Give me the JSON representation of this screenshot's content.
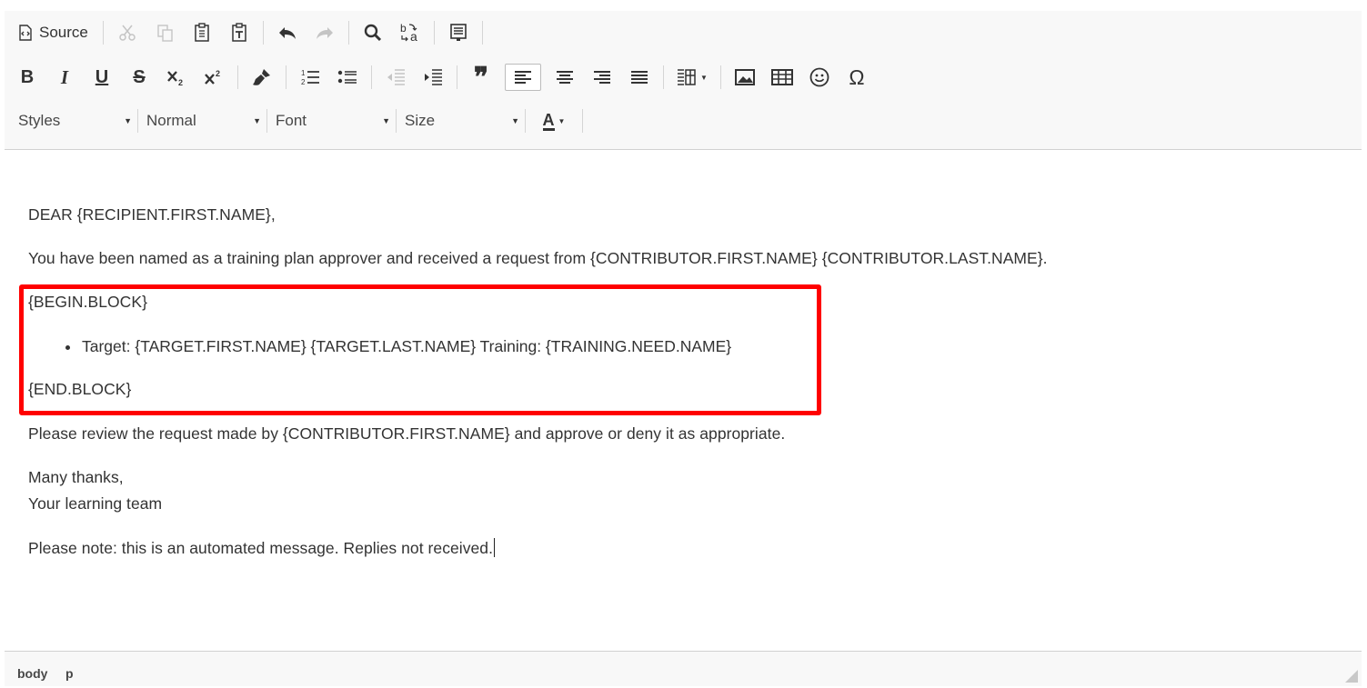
{
  "toolbar": {
    "source_label": "Source",
    "styles_label": "Styles",
    "format_label": "Normal",
    "font_label": "Font",
    "size_label": "Size",
    "bold_glyph": "B",
    "italic_glyph": "I",
    "underline_glyph": "U",
    "strike_glyph": "S",
    "blockquote_glyph": "❞",
    "omega_glyph": "Ω",
    "text_color_glyph": "A"
  },
  "content": {
    "greeting": "DEAR {RECIPIENT.FIRST.NAME},",
    "intro": "You have been named as a training plan approver and received a request from {CONTRIBUTOR.FIRST.NAME} {CONTRIBUTOR.LAST.NAME}.",
    "begin_block": "{BEGIN.BLOCK}",
    "bullet_item": "Target: {TARGET.FIRST.NAME} {TARGET.LAST.NAME} Training: {TRAINING.NEED.NAME}",
    "end_block": "{END.BLOCK}",
    "review": "Please review the request made by {CONTRIBUTOR.FIRST.NAME} and approve or deny it as appropriate.",
    "thanks": "Many thanks,",
    "signature": "Your learning team",
    "note": "Please note: this is an automated message. Replies not received."
  },
  "statusbar": {
    "path": [
      "body",
      "p"
    ]
  },
  "colors": {
    "highlight": "#ff0000",
    "toolbar_bg": "#f8f8f8",
    "text": "#333333"
  }
}
